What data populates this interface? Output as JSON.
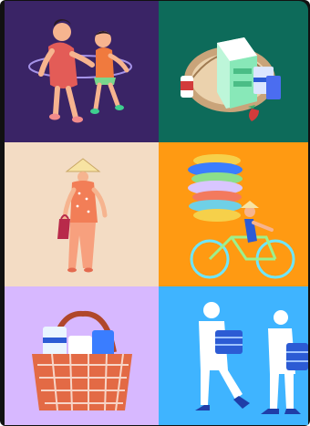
{
  "tiles": [
    {
      "id": "children-playing",
      "bg": "#3a2466",
      "caption": ""
    },
    {
      "id": "market-basket-milk",
      "bg": "#0d6b5a",
      "caption": ""
    },
    {
      "id": "woman-conical-hat",
      "bg": "#f3dcc4",
      "caption": ""
    },
    {
      "id": "vendor-bicycle",
      "bg": "#ff9a12",
      "caption": ""
    },
    {
      "id": "woven-basket",
      "bg": "#d7b8ff",
      "caption": ""
    },
    {
      "id": "workers-carrying-crates",
      "bg": "#3fb4ff",
      "caption": ""
    }
  ],
  "colors": {
    "frame": "#111111",
    "ink": "#3a2a22",
    "skin": "#f6b48f",
    "white": "#ffffff",
    "blue": "#2c5bd4",
    "green": "#4bbd86"
  }
}
